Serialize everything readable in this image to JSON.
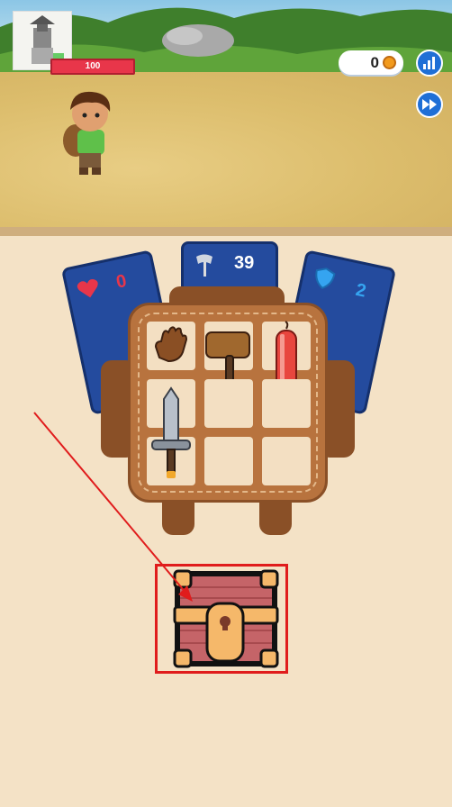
{
  "hud": {
    "player_hp": "100",
    "coins": "0",
    "icons": {
      "portrait": "castle-portrait-icon",
      "coin": "coin-icon",
      "stats": "bar-chart-icon",
      "speed": "fast-forward-icon"
    }
  },
  "stats": {
    "health": "0",
    "attack": "39",
    "defense": "2"
  },
  "inventory": {
    "items": [
      "glove",
      "wooden-mallet",
      "dynamite",
      "sword",
      "",
      "",
      "",
      "",
      ""
    ]
  },
  "chest": {
    "icon": "treasure-chest-icon"
  },
  "colors": {
    "accent_blue": "#244b9e",
    "hp_red": "#e8364a",
    "highlight_red": "#e01c1c"
  }
}
